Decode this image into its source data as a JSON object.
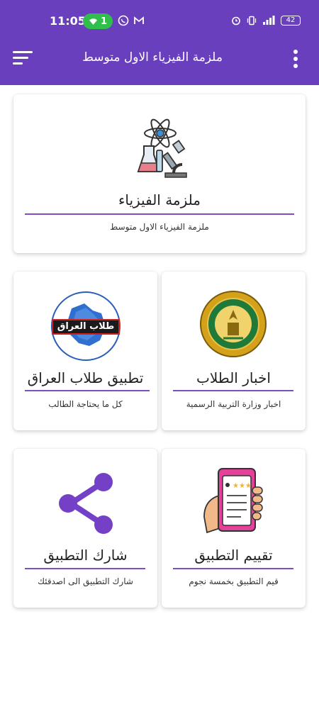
{
  "status_bar": {
    "time": "11:05",
    "wifi_badge": "1",
    "battery": "42"
  },
  "app_bar": {
    "title": "ملزمة الفيزياء الاول متوسط",
    "color": "#6a3fbd"
  },
  "cards": [
    {
      "title": "ملزمة الفيزياء",
      "subtitle": "ملزمة الفيزياء الاول متوسط",
      "icon": "science-lab-icon"
    },
    {
      "title": "تطبيق طلاب العراق",
      "subtitle": "كل ما يحتاجة الطالب",
      "icon": "iraq-students-logo",
      "logo_text": "طلاب العراق"
    },
    {
      "title": "اخبار الطلاب",
      "subtitle": "اخبار وزارة التربية الرسمية",
      "icon": "ministry-seal-icon",
      "seal_text": "REPUBLIC OF IRAQ MINISTRY OF EDUCATION"
    },
    {
      "title": "شارك التطبيق",
      "subtitle": "شارك التطبيق الى اصدقئك",
      "icon": "share-icon"
    },
    {
      "title": "تقييم التطبيق",
      "subtitle": "قيم التطبيق بخمسة نجوم",
      "icon": "rate-phone-icon"
    }
  ]
}
